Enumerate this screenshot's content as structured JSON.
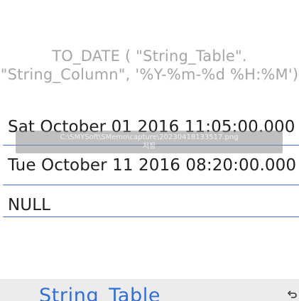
{
  "formula": {
    "line1": "TO_DATE ( \"String_Table\".",
    "line2": "\"String_Column\", '%Y-%m-%d %H:%M')"
  },
  "results": [
    {
      "value": "Sat October 01 2016 11:05:00.000"
    },
    {
      "value": "Tue October 11 2016 08:20:00.000"
    },
    {
      "value": "NULL"
    }
  ],
  "toast": {
    "path": "C:\\SMYSoft\\SMemo\\capture\\20230418133517.png",
    "action": "저장"
  },
  "bottom": {
    "tab_title": "String_Table",
    "corner_icon": "undo-icon"
  }
}
